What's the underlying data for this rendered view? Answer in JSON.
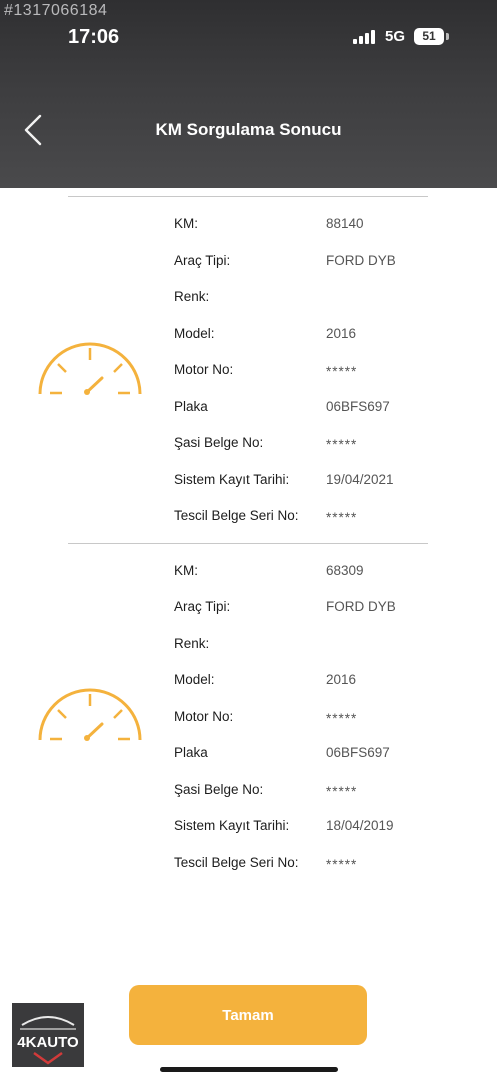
{
  "watermark_id": "#1317066184",
  "status_bar": {
    "time": "17:06",
    "network": "5G",
    "battery": "51"
  },
  "header": {
    "title": "KM Sorgulama Sonucu",
    "back_icon": "chevron-left-icon"
  },
  "records": [
    {
      "icon": "speedometer-icon",
      "fields": [
        {
          "label": "KM:",
          "value": "88140"
        },
        {
          "label": "Araç Tipi:",
          "value": "FORD DYB"
        },
        {
          "label": "Renk:",
          "value": ""
        },
        {
          "label": "Model:",
          "value": "2016"
        },
        {
          "label": "Motor No:",
          "value": "*****"
        },
        {
          "label": "Plaka",
          "value": "06BFS697"
        },
        {
          "label": "Şasi Belge No:",
          "value": "*****"
        },
        {
          "label": "Sistem Kayıt Tarihi:",
          "value": "19/04/2021"
        },
        {
          "label": "Tescil Belge Seri No:",
          "value": "*****"
        }
      ]
    },
    {
      "icon": "speedometer-icon",
      "fields": [
        {
          "label": "KM:",
          "value": "68309"
        },
        {
          "label": "Araç Tipi:",
          "value": "FORD DYB"
        },
        {
          "label": "Renk:",
          "value": ""
        },
        {
          "label": "Model:",
          "value": "2016"
        },
        {
          "label": "Motor No:",
          "value": "*****"
        },
        {
          "label": "Plaka",
          "value": "06BFS697"
        },
        {
          "label": "Şasi Belge No:",
          "value": "*****"
        },
        {
          "label": "Sistem Kayıt Tarihi:",
          "value": "18/04/2019"
        },
        {
          "label": "Tescil Belge Seri No:",
          "value": "*****"
        }
      ]
    }
  ],
  "footer": {
    "ok_label": "Tamam"
  },
  "logo": {
    "text": "4KAUTO",
    "icon": "4k-auto-logo-icon"
  },
  "colors": {
    "accent": "#f4b23d",
    "header_bg": "#3d3d3f",
    "text": "#1d1d1d",
    "muted": "#555555"
  }
}
